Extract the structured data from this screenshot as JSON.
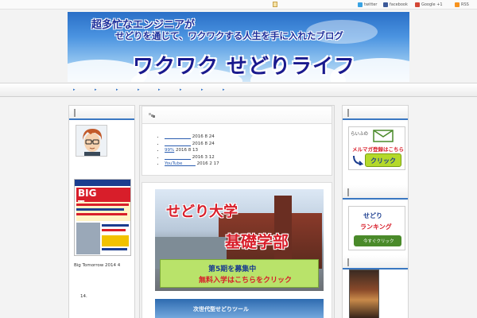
{
  "topbar": {
    "twitter": "twitter",
    "facebook": "facebook",
    "google": "Google +1",
    "rss": "RSS"
  },
  "header": {
    "line1": "超多忙なエンジニアが",
    "line2": "せどりを通じて、ワクワクする人生を手に入れたブログ",
    "title": "ワクワク せどりライフ"
  },
  "nav": {
    "items": [
      "▸",
      "▸",
      "▸",
      "▸",
      "▸",
      "▸",
      "▸",
      "▸"
    ]
  },
  "left": {
    "magazine_title": "BIG Tomorrow",
    "magazine_caption": "Big Tomorrow 2014 4",
    "number": "14."
  },
  "main": {
    "posts": [
      {
        "title": "____________",
        "date": "2016 8 24"
      },
      {
        "title": "____________",
        "date": "2016 8 24"
      },
      {
        "title": "99%",
        "date": "2016 8 13"
      },
      {
        "title": "____________",
        "date": "2016 3 12"
      },
      {
        "title": "YouTube______",
        "date": "2016 2 17"
      }
    ],
    "ad": {
      "title": "せどり大学",
      "subtitle": "基礎学部",
      "recruit": "第5期を募集中",
      "free": "無料入学はこちらをクリック",
      "tool": "次世代型せどりツール"
    }
  },
  "right": {
    "mail_from": "らいふの",
    "mail_label": "メルマガ登録はこちら",
    "mail_button": "クリック",
    "rank_line1": "せどり",
    "rank_line2": "ランキング",
    "rank_button": "今すぐクリック"
  },
  "colors": {
    "accent": "#3a78c2",
    "red": "#d81e2a",
    "navy": "#1b3d8f"
  }
}
